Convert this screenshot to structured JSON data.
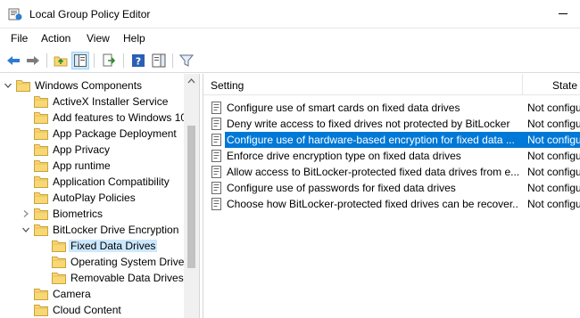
{
  "window": {
    "title": "Local Group Policy Editor",
    "app_icon": "group-policy-icon"
  },
  "menu": [
    "File",
    "Action",
    "View",
    "Help"
  ],
  "toolbar": {
    "buttons": [
      "back-arrow-icon",
      "forward-arrow-icon",
      "up-folder-icon",
      "show-hide-tree-icon",
      "export-list-icon",
      "help-icon",
      "show-hide-action-pane-icon",
      "filter-icon"
    ],
    "active": "show-hide-tree-icon"
  },
  "tree": {
    "items": [
      {
        "label": "Windows Components",
        "expander": "expanded",
        "depth": 0
      },
      {
        "label": "ActiveX Installer Service",
        "expander": "none",
        "depth": 1
      },
      {
        "label": "Add features to Windows 10",
        "expander": "none",
        "depth": 1
      },
      {
        "label": "App Package Deployment",
        "expander": "none",
        "depth": 1
      },
      {
        "label": "App Privacy",
        "expander": "none",
        "depth": 1
      },
      {
        "label": "App runtime",
        "expander": "none",
        "depth": 1
      },
      {
        "label": "Application Compatibility",
        "expander": "none",
        "depth": 1
      },
      {
        "label": "AutoPlay Policies",
        "expander": "none",
        "depth": 1
      },
      {
        "label": "Biometrics",
        "expander": "collapsed",
        "depth": 1
      },
      {
        "label": "BitLocker Drive Encryption",
        "expander": "expanded",
        "depth": 1
      },
      {
        "label": "Fixed Data Drives",
        "expander": "none",
        "depth": 2,
        "selected": true
      },
      {
        "label": "Operating System Drives",
        "expander": "none",
        "depth": 2
      },
      {
        "label": "Removable Data Drives",
        "expander": "none",
        "depth": 2
      },
      {
        "label": "Camera",
        "expander": "none",
        "depth": 1
      },
      {
        "label": "Cloud Content",
        "expander": "none",
        "depth": 1
      }
    ]
  },
  "list": {
    "columns": {
      "setting": "Setting",
      "state": "State"
    },
    "rows": [
      {
        "setting": "Configure use of smart cards on fixed data drives",
        "state": "Not configu"
      },
      {
        "setting": "Deny write access to fixed drives not protected by BitLocker",
        "state": "Not configu"
      },
      {
        "setting": "Configure use of hardware-based encryption for fixed data ...",
        "state": "Not configu",
        "selected": true
      },
      {
        "setting": "Enforce drive encryption type on fixed data drives",
        "state": "Not configu"
      },
      {
        "setting": "Allow access to BitLocker-protected fixed data drives from e...",
        "state": "Not configu"
      },
      {
        "setting": "Configure use of passwords for fixed data drives",
        "state": "Not configu"
      },
      {
        "setting": "Choose how BitLocker-protected fixed drives can be recover...",
        "state": "Not configu"
      }
    ]
  },
  "colors": {
    "selection_blue": "#0078d7",
    "tree_selection": "#cce8ff",
    "folder_yellow": "#f8d775"
  }
}
